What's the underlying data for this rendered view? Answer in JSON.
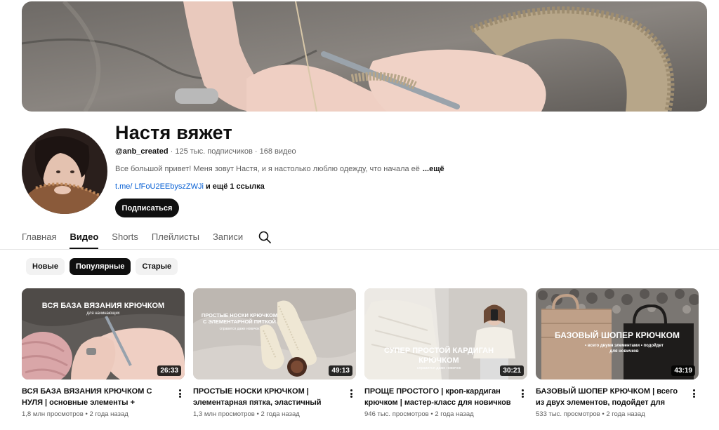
{
  "channel": {
    "name": "Настя вяжет",
    "handle": "@anb_created",
    "subscribers": "125 тыс. подписчиков",
    "videos_count": "168 видео",
    "separator": " · ",
    "description": "Все большой привет! Меня зовут Настя, и я настолько люблю одежду, что начала её",
    "more_label": "...ещё",
    "link_text": "t.me/ LfFoU2EEbyszZWJi",
    "link_extra": "и ещё 1 ссылка",
    "subscribe_label": "Подписаться"
  },
  "tabs": [
    {
      "label": "Главная"
    },
    {
      "label": "Видео",
      "active": true
    },
    {
      "label": "Shorts"
    },
    {
      "label": "Плейлисты"
    },
    {
      "label": "Записи"
    }
  ],
  "search_icon": "search-icon",
  "chips": [
    {
      "label": "Новые"
    },
    {
      "label": "Популярные",
      "active": true
    },
    {
      "label": "Старые"
    }
  ],
  "videos": [
    {
      "title": "ВСЯ БАЗА ВЯЗАНИЯ КРЮЧКОМ С НУЛЯ | основные элементы + обозначения в...",
      "views": "1,8 млн просмотров",
      "age": "2 года назад",
      "duration": "26:33",
      "thumb_text": "ВСЯ БАЗА ВЯЗАНИЯ КРЮЧКОМ",
      "thumb_sub": "для начинающих"
    },
    {
      "title": "ПРОСТЫЕ НОСКИ КРЮЧКОМ | элементарная пятка, эластичный набор ...",
      "views": "1,3 млн просмотров",
      "age": "2 года назад",
      "duration": "49:13",
      "thumb_text": "ПРОСТЫЕ НОСКИ КРЮЧКОМ С ЭЛЕМЕНТАРНОЙ ПЯТКОЙ",
      "thumb_sub": "справится даже новичок"
    },
    {
      "title": "ПРОЩЕ ПРОСТОГО | кроп-кардиган крючком | мастер-класс для новичков",
      "views": "946 тыс. просмотров",
      "age": "2 года назад",
      "duration": "30:21",
      "thumb_text": "СУПЕР ПРОСТОЙ КАРДИГАН КРЮЧКОМ",
      "thumb_sub": "справится даже новичок"
    },
    {
      "title": "БАЗОВЫЙ ШОПЕР КРЮЧКОМ | всего из двух элементов, подойдет для новичков",
      "views": "533 тыс. просмотров",
      "age": "2 года назад",
      "duration": "43:19",
      "thumb_text": "БАЗОВЫЙ ШОПЕР КРЮЧКОМ",
      "thumb_sub": "• всего двумя элементами • подойдет для новичков"
    }
  ],
  "colors": {
    "link": "#065fd4",
    "primary_text": "#0f0f0f",
    "secondary_text": "#606060",
    "button_bg": "#0f0f0f"
  }
}
